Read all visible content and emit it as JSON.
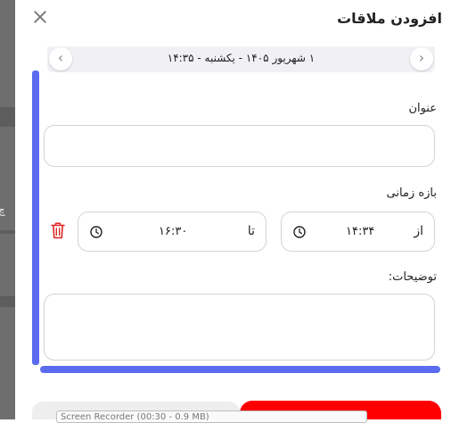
{
  "modal": {
    "title": "افزودن ملاقات",
    "date_label": "۱ شهریور ۱۴۰۵ - یکشنبه - ۱۴:۳۵"
  },
  "form": {
    "title_label": "عنوان",
    "title_value": "",
    "range_label": "بازه زمانی",
    "from_prefix": "از",
    "from_time": "۱۴:۳۴",
    "to_prefix": "تا",
    "to_time": "۱۶:۳۰",
    "description_label": "توضیحات:",
    "description_value": ""
  },
  "background": {
    "partial_text": "چ"
  },
  "recorder": {
    "text": "Screen Recorder (00:30 - 0.9 MB)"
  },
  "icons": [
    "close-icon",
    "chevron-left-icon",
    "chevron-right-icon",
    "clock-icon",
    "trash-icon"
  ],
  "colors": {
    "accent": "#5b6cf0",
    "danger": "#ff0000",
    "trash": "#e02424"
  }
}
